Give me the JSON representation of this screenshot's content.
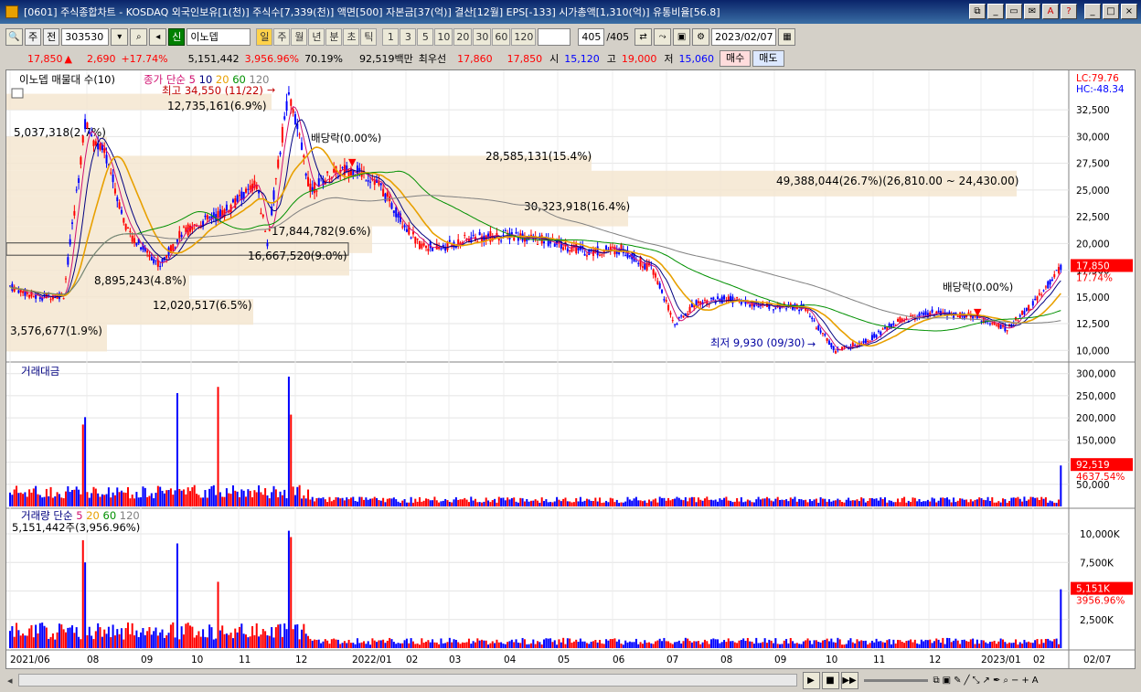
{
  "window": {
    "title": "[0601] 주식종합차트 - KOSDAQ 외국인보유[1(천)] 주식수[7,339(천)] 액면[500] 자본금[37(억)] 결산[12월] EPS[-133] 시가총액[1,310(억)] 유통비율[56.8]"
  },
  "toolbar": {
    "type_select": "주",
    "prev_label": "전",
    "code": "303530",
    "new_badge": "신",
    "stock_name": "이노뎁",
    "periods": [
      "일",
      "주",
      "월",
      "년",
      "분",
      "초",
      "틱"
    ],
    "intervals": [
      "1",
      "3",
      "5",
      "10",
      "20",
      "30",
      "60",
      "120"
    ],
    "count": "405",
    "count_total": "/405",
    "date": "2023/02/07"
  },
  "quote": {
    "price": "17,850",
    "change": "2,690",
    "change_pct": "+17.74%",
    "volume": "5,151,442",
    "volume_pct": "3,956.96%",
    "ratio": "70.19%",
    "amount": "92,519백만",
    "best_label": "최우선",
    "best_ask": "17,860",
    "best_bid": "17,850",
    "open_label": "시",
    "open": "15,120",
    "high_label": "고",
    "high": "19,000",
    "low_label": "저",
    "low": "15,060",
    "buy": "매수",
    "sell": "매도"
  },
  "legend": {
    "profile_label": "이노뎁 매물대 수(10)",
    "ma_label": "종가 단순",
    "ma_periods": [
      "5",
      "10",
      "20",
      "60",
      "120"
    ],
    "amount_title": "거래대금",
    "volume_title": "거래량 단순",
    "volume_ma_periods": [
      "5",
      "20",
      "60",
      "120"
    ],
    "volume_value": "5,151,442주(3,956.96%)"
  },
  "chart_annotations": {
    "lc": "LC:79.76",
    "hc": "HC:-48.34",
    "high_note": "최고 34,550 (11/22)",
    "low_note": "최저 9,930 (09/30)",
    "dividend1": "배당락(0.00%)",
    "dividend2": "배당락(0.00%)",
    "price_tag": "17,850",
    "pct_tag": "17.74%",
    "amount_tag": "92,519",
    "amount_pct_tag": "4637.54%",
    "volume_tag": "5,151K",
    "volume_pct_tag": "3956.96%"
  },
  "profile_labels": [
    "12,735,161(6.9%)",
    "5,037,318(2.7%)",
    "28,585,131(15.4%)",
    "49,388,044(26.7%)(26,810.00 ~ 24,430.00)",
    "30,323,918(16.4%)",
    "17,844,782(9.6%)",
    "16,667,520(9.0%)",
    "8,895,243(4.8%)",
    "12,020,517(6.5%)",
    "3,576,677(1.9%)"
  ],
  "colors": {
    "up": "#ff0000",
    "down": "#0000ff",
    "profile": "#f5e6d0",
    "ma5": "#d01070",
    "ma10": "#000080",
    "ma20": "#e8a000",
    "ma60": "#009000",
    "ma120": "#808080"
  },
  "chart_data": {
    "type": "candlestick",
    "price_axis": {
      "ticks": [
        "32,500",
        "30,000",
        "27,500",
        "25,000",
        "22,500",
        "20,000",
        "17,500",
        "15,000",
        "12,500",
        "10,000"
      ],
      "ylim": [
        9000,
        35500
      ]
    },
    "amount_axis": {
      "ticks": [
        "300,000",
        "250,000",
        "200,000",
        "150,000",
        "100,000",
        "50,000"
      ],
      "ylim": [
        0,
        320000
      ]
    },
    "volume_axis": {
      "ticks": [
        "10,000K",
        "7,500K",
        "5,000K",
        "2,500K"
      ],
      "ylim": [
        0,
        12000
      ]
    },
    "x_labels": [
      "2021/06",
      "08",
      "09",
      "10",
      "11",
      "12",
      "2022/01",
      "02",
      "03",
      "04",
      "05",
      "06",
      "07",
      "08",
      "09",
      "10",
      "11",
      "12",
      "2023/01",
      "02",
      "02/07"
    ],
    "price_path": [
      [
        0,
        16000
      ],
      [
        12,
        15000
      ],
      [
        25,
        15200
      ],
      [
        35,
        31000
      ],
      [
        45,
        28000
      ],
      [
        55,
        21000
      ],
      [
        70,
        18000
      ],
      [
        80,
        21000
      ],
      [
        100,
        23000
      ],
      [
        115,
        25500
      ],
      [
        120,
        20000
      ],
      [
        130,
        34550
      ],
      [
        140,
        25000
      ],
      [
        150,
        26500
      ],
      [
        160,
        27000
      ],
      [
        170,
        26000
      ],
      [
        180,
        23000
      ],
      [
        190,
        20000
      ],
      [
        200,
        19500
      ],
      [
        215,
        20500
      ],
      [
        235,
        20800
      ],
      [
        255,
        20000
      ],
      [
        270,
        19200
      ],
      [
        285,
        19500
      ],
      [
        300,
        17500
      ],
      [
        310,
        12400
      ],
      [
        320,
        14500
      ],
      [
        335,
        14800
      ],
      [
        350,
        14200
      ],
      [
        370,
        14000
      ],
      [
        385,
        9930
      ],
      [
        400,
        11000
      ],
      [
        415,
        12800
      ],
      [
        430,
        13500
      ],
      [
        450,
        13200
      ],
      [
        465,
        12000
      ],
      [
        480,
        15000
      ],
      [
        490,
        17850
      ]
    ]
  }
}
